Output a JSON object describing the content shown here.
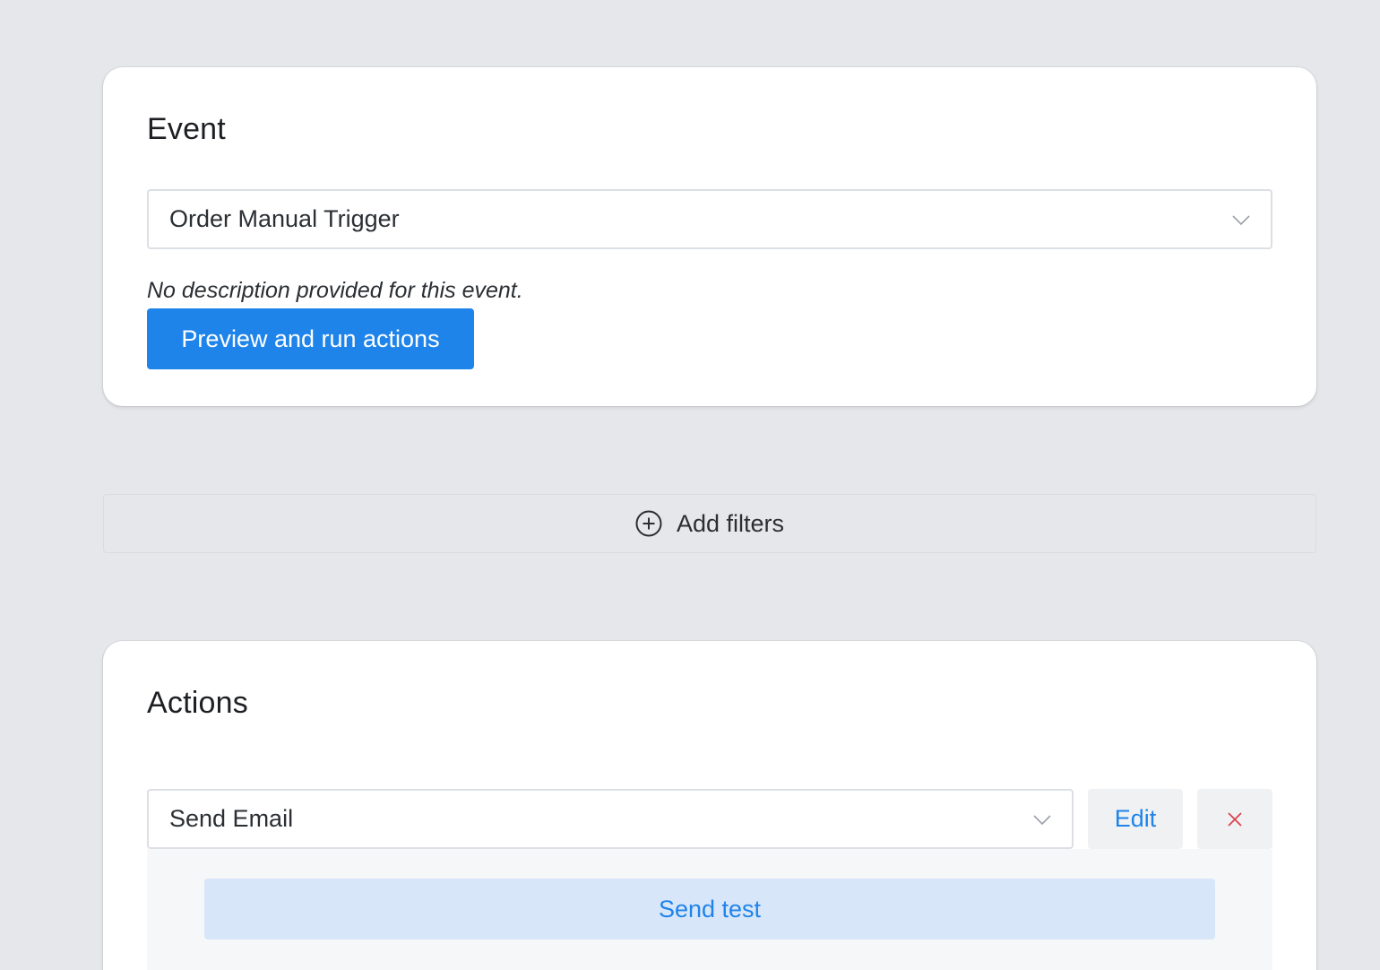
{
  "event_card": {
    "title": "Event",
    "event_select": {
      "selected_value": "Order Manual Trigger",
      "icon": "chevron-down-icon"
    },
    "description": "No description provided for this event.",
    "preview_button_label": "Preview and run actions"
  },
  "filters": {
    "add_filters_label": "Add filters",
    "icon": "plus-circle-icon"
  },
  "actions_card": {
    "title": "Actions",
    "action_select": {
      "selected_value": "Send Email",
      "icon": "chevron-down-icon"
    },
    "edit_button_label": "Edit",
    "remove_icon": "close-icon",
    "send_test_label": "Send test"
  },
  "colors": {
    "background": "#e5e7eb",
    "primary": "#1f84ea",
    "danger": "#d9434e",
    "send_test_bg": "#d8e6f9"
  }
}
